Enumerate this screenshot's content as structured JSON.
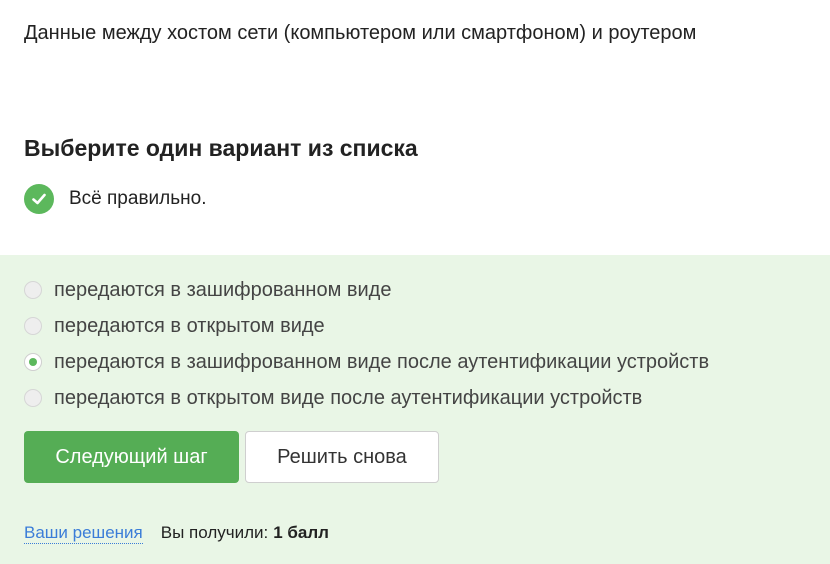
{
  "question": {
    "text": "Данные между хостом сети (компьютером или смартфоном) и роутером"
  },
  "task": {
    "heading": "Выберите один вариант из списка"
  },
  "feedback": {
    "status_text": "Всё правильно.",
    "status_icon": "check-circle-icon",
    "status_color": "#5cb85c"
  },
  "options": [
    {
      "label": "передаются в зашифрованном виде",
      "selected": false
    },
    {
      "label": "передаются в открытом виде",
      "selected": false
    },
    {
      "label": "передаются в зашифрованном виде после аутентификации устройств",
      "selected": true
    },
    {
      "label": "передаются в открытом виде после аутентификации устройств",
      "selected": false
    }
  ],
  "actions": {
    "next_label": "Следующий шаг",
    "retry_label": "Решить снова"
  },
  "footer": {
    "solutions_link": "Ваши решения",
    "score_label": "Вы получили:",
    "score_value": "1 балл"
  },
  "colors": {
    "accent_green": "#55ad55",
    "panel_background": "#e9f6e6",
    "link_blue": "#3b7dd8"
  }
}
